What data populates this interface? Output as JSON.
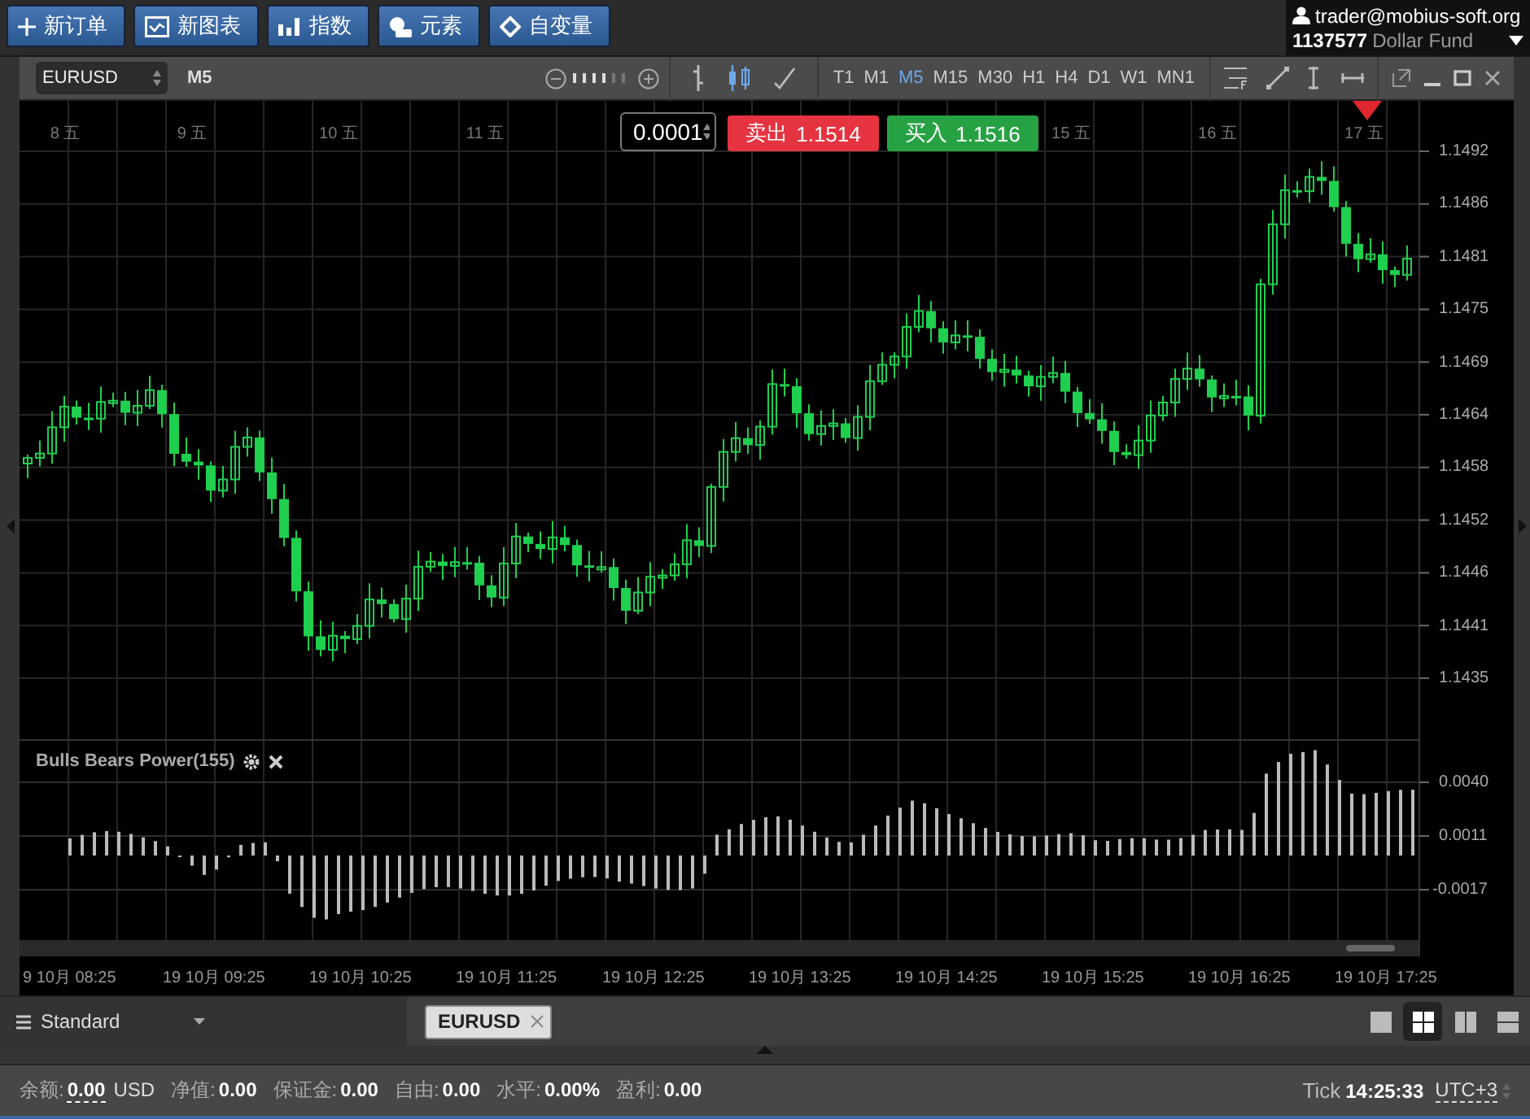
{
  "toolbar": {
    "buttons": [
      {
        "kind": "plus",
        "label": "新订单"
      },
      {
        "kind": "chart",
        "label": "新图表"
      },
      {
        "kind": "bars",
        "label": "指数"
      },
      {
        "kind": "shapes",
        "label": "元素"
      },
      {
        "kind": "diamond",
        "label": "自变量"
      }
    ]
  },
  "account": {
    "email": "trader@mobius-soft.org",
    "number": "1137577",
    "name": "Dollar Fund"
  },
  "chart_window": {
    "symbol": "EURUSD",
    "timeframe_label": "M5",
    "chart_types": [
      {
        "kind": "bar",
        "selected": false
      },
      {
        "kind": "candle",
        "selected": true
      },
      {
        "kind": "line",
        "selected": false
      }
    ],
    "timeframes": [
      {
        "label": "T1",
        "selected": false
      },
      {
        "label": "M1",
        "selected": false
      },
      {
        "label": "M5",
        "selected": true
      },
      {
        "label": "M15",
        "selected": false
      },
      {
        "label": "M30",
        "selected": false
      },
      {
        "label": "H1",
        "selected": false
      },
      {
        "label": "H4",
        "selected": false
      },
      {
        "label": "D1",
        "selected": false
      },
      {
        "label": "W1",
        "selected": false
      },
      {
        "label": "MN1",
        "selected": false
      }
    ],
    "lot": "0.0001",
    "sell": {
      "label": "卖出",
      "price": "1.1514"
    },
    "buy": {
      "label": "买入",
      "price": "1.1516"
    },
    "day_labels": [
      "8 五",
      "9 五",
      "10 五",
      "11 五",
      "15 五",
      "16 五",
      "17 五"
    ],
    "price_ticks": [
      "1.1492",
      "1.1486",
      "1.1481",
      "1.1475",
      "1.1469",
      "1.1464",
      "1.1458",
      "1.1452",
      "1.1446",
      "1.1441",
      "1.1435"
    ],
    "indicator": {
      "title": "Bulls Bears Power(155)",
      "ticks": [
        "0.0040",
        "0.0011",
        "-0.0017"
      ]
    },
    "time_labels": [
      "9 10月 08:25",
      "19 10月 09:25",
      "19 10月 10:25",
      "19 10月 11:25",
      "19 10月 12:25",
      "19 10月 13:25",
      "19 10月 14:25",
      "19 10月 15:25",
      "19 10月 16:25",
      "19 10月 17:25"
    ]
  },
  "bottom_bar": {
    "template": "Standard",
    "tabs": [
      {
        "label": "EURUSD",
        "selected": true
      }
    ],
    "layouts": [
      {
        "kind": "single",
        "selected": false
      },
      {
        "kind": "grid",
        "selected": true
      },
      {
        "kind": "columns",
        "selected": false
      },
      {
        "kind": "rows",
        "selected": false
      }
    ]
  },
  "status_bar": {
    "items": [
      {
        "label": "余额:",
        "value": "0.00",
        "unit": "USD"
      },
      {
        "label": "净值:",
        "value": "0.00"
      },
      {
        "label": "保证金:",
        "value": "0.00"
      },
      {
        "label": "自由:",
        "value": "0.00"
      },
      {
        "label": "水平:",
        "value": "0.00%"
      },
      {
        "label": "盈利:",
        "value": "0.00"
      }
    ],
    "tick_label": "Tick",
    "time": "14:25:33",
    "timezone": "UTC+3"
  }
}
